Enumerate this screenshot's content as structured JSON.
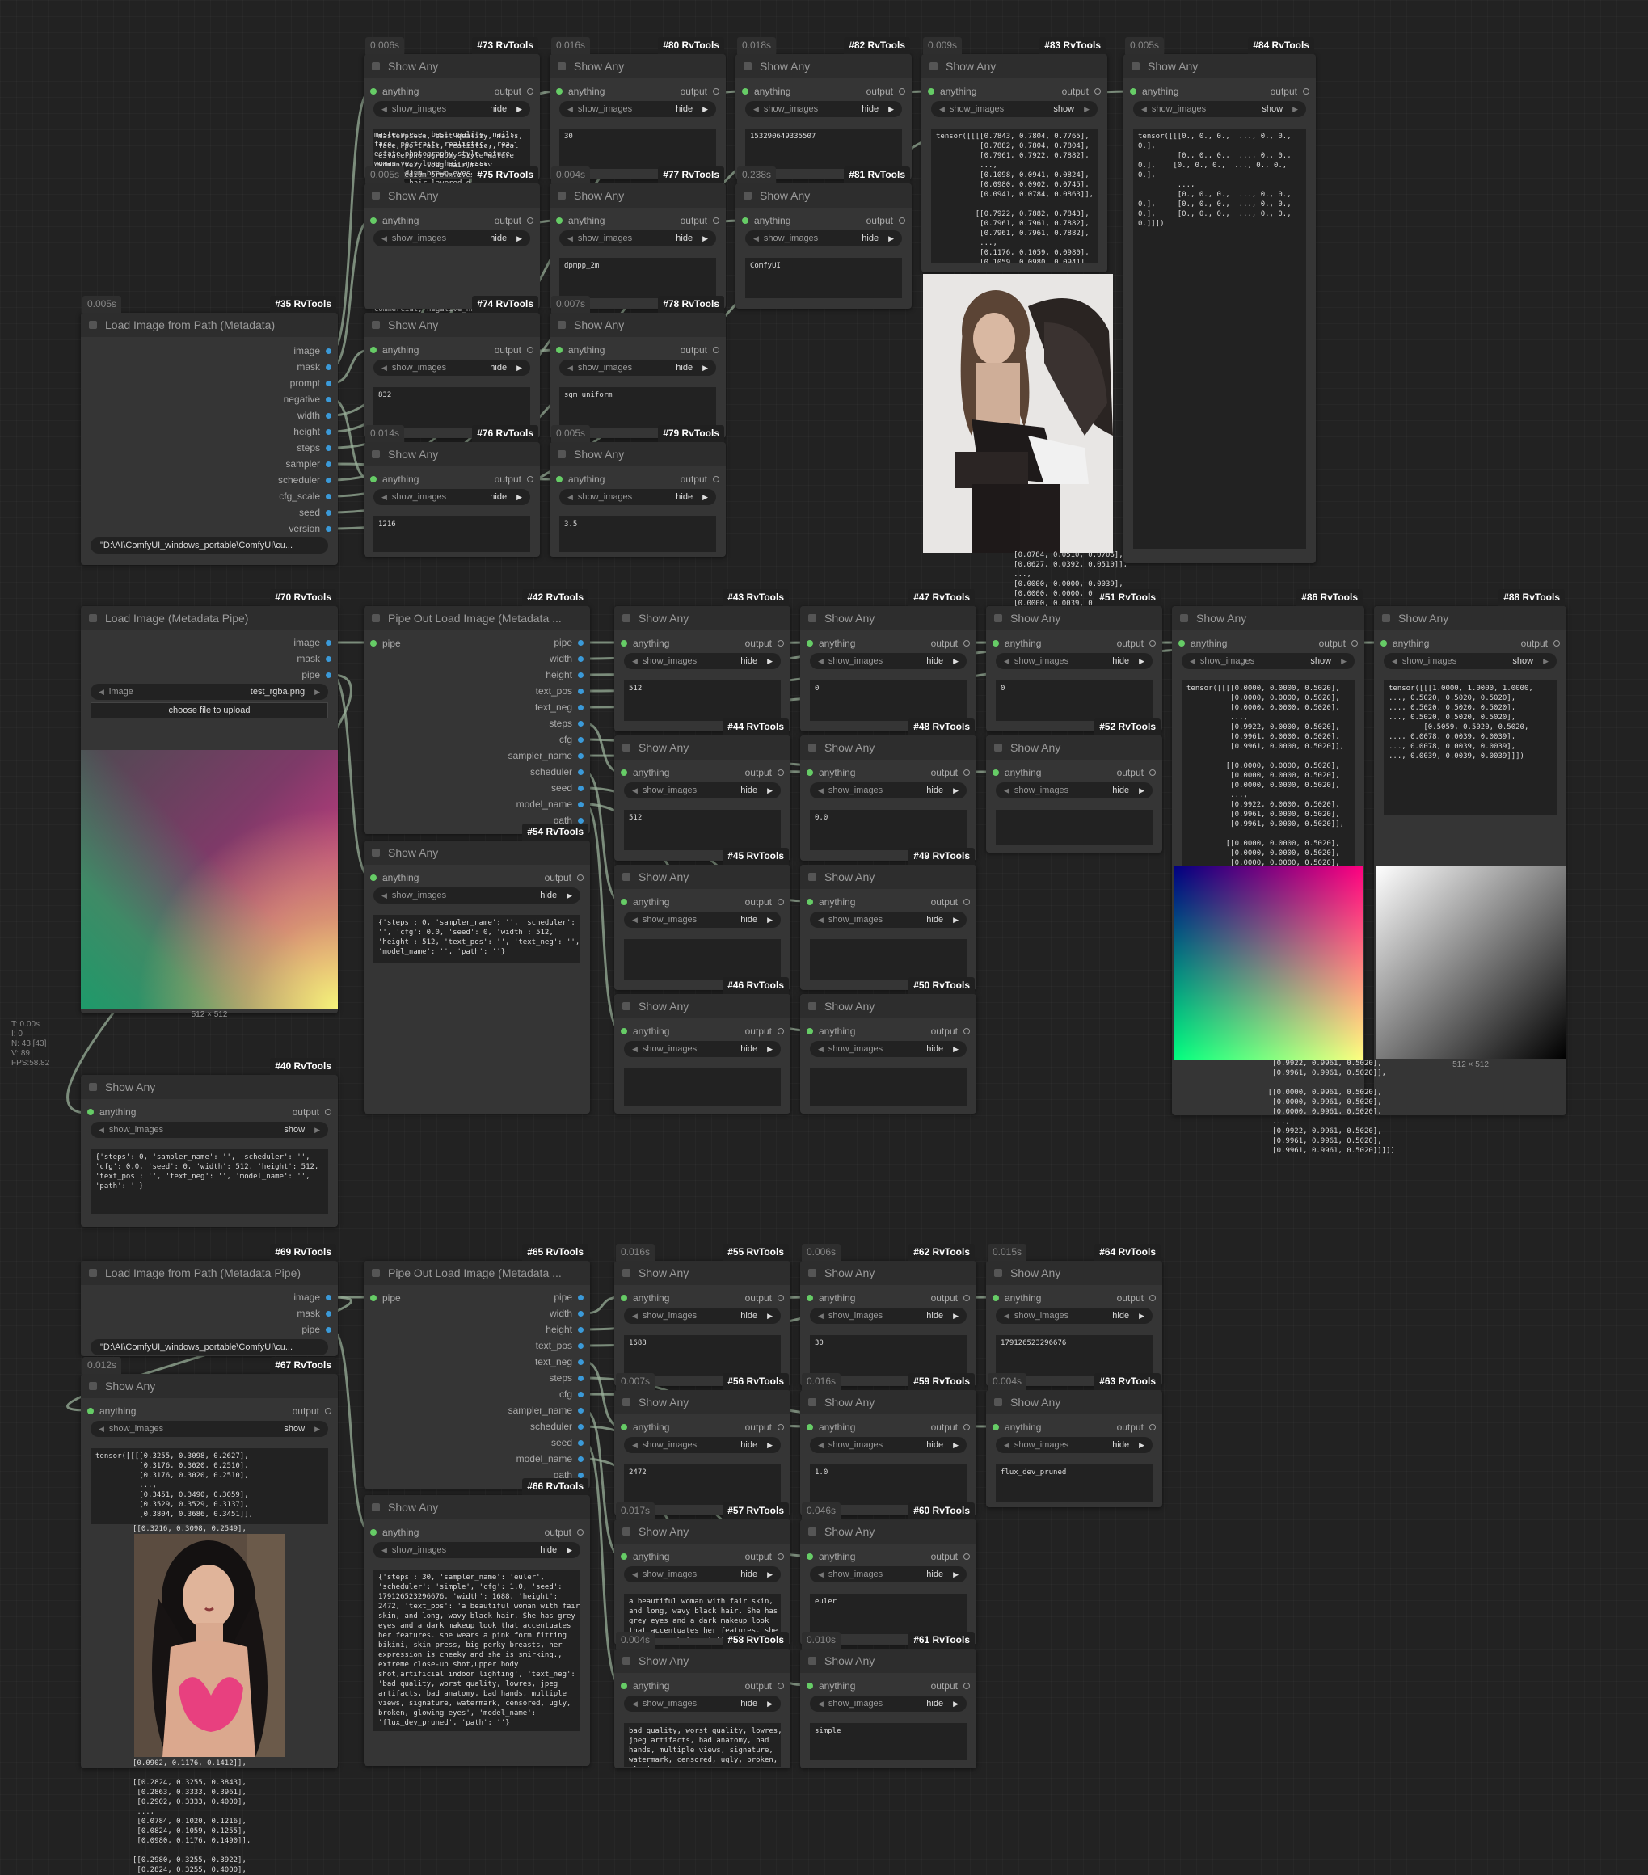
{
  "stats": [
    "T: 0.00s",
    "I: 0",
    "N: 43 [43]",
    "V: 89",
    "FPS:58.82"
  ],
  "common": {
    "show_any": "Show Any",
    "anything": "anything",
    "output": "output",
    "show_images": "show_images",
    "hide": "hide",
    "show": "show",
    "pipe": "pipe"
  },
  "nodes": {
    "n35": {
      "badge": "#35 RvTools",
      "time": "0.005s",
      "title": "Load Image from Path (Metadata)",
      "outputs": [
        "image",
        "mask",
        "prompt",
        "negative",
        "width",
        "height",
        "steps",
        "sampler",
        "scheduler",
        "cfg_scale",
        "seed",
        "version"
      ],
      "path": "\"D:\\AI\\ComfyUI_windows_portable\\ComfyUI\\cu..."
    },
    "n73": {
      "badge": "#73 RvTools",
      "time": "0.006s",
      "text": "masterpiece, best quality, nails,\nface, portrait, realistic,, real\nestate photography style mature\nwoman,very long hair,messy\nhair,medium brown,eyes visible\nthrough hair,layered dress,angel\nwings,tattoo,torn\nthighhighs,dagger,,\nsideways,eye-level shot,Alejandro\nJodorowsky,chris leib,Lifestyle\nPhotography,subdued\nnightlight,Tranquil\nAtmosphere,Photorealism,, starry\nsky\",\"text_neg\": \"blurry, noisy,\nlow resolution, low quality, worst\nquality, vibrant, lens flare,\nbadscales,bad anatomy, bad hands,\nerror, missing, lowres,\ncommercial, negative_hand,\nmasterpiece, best quality, nails,\nface, portrait, realistic,"
    },
    "n80": {
      "badge": "#80 RvTools",
      "time": "0.016s",
      "text": "30"
    },
    "n82": {
      "badge": "#82 RvTools",
      "time": "0.018s",
      "text": "153290649335507"
    },
    "n83": {
      "badge": "#83 RvTools",
      "time": "0.009s",
      "text": "tensor([[[[0.7843, 0.7804, 0.7765],\n          [0.7882, 0.7804, 0.7804],\n          [0.7961, 0.7922, 0.7882],\n          ...,\n          [0.1098, 0.0941, 0.0824],\n          [0.0980, 0.0902, 0.0745],\n          [0.0941, 0.0784, 0.0863]],\n\n         [[0.7922, 0.7882, 0.7843],\n          [0.7961, 0.7961, 0.7882],\n          [0.7961, 0.7961, 0.7882],\n          ...,\n          [0.1176, 0.1059, 0.0980],\n          [0.1059, 0.0980, 0.0941],\n          [0.0902, 0.0784, 0.0824]],",
      "overflow": "          [0.0784, 0.0510, 0.0706],\n          [0.0627, 0.0392, 0.0510]],\n          ...,\n          [0.0000, 0.0000, 0.0039],\n          [0.0000, 0.0000, 0.0000],\n          [0.0000, 0.0039, 0.0196]]]])"
    },
    "n84": {
      "badge": "#84 RvTools",
      "time": "0.005s",
      "text": "tensor([[[0., 0., 0.,  ..., 0., 0.,\n0.],\n         [0., 0., 0.,  ..., 0., 0.,\n0.],    [0., 0., 0.,  ..., 0., 0.,\n0.],\n         ...,\n         [0., 0., 0.,  ..., 0., 0.,\n0.],     [0., 0., 0.,  ..., 0., 0.,\n0.],     [0., 0., 0.,  ..., 0., 0.,\n0.]]])"
    },
    "n75": {
      "badge": "#75 RvTools",
      "time": "0.005s"
    },
    "n77": {
      "badge": "#77 RvTools",
      "time": "0.004s",
      "text": "dpmpp_2m"
    },
    "n81": {
      "badge": "#81 RvTools",
      "time": "0.238s",
      "text": "ComfyUI"
    },
    "n74": {
      "badge": "#74 RvTools",
      "time": "",
      "text": "832"
    },
    "n78": {
      "badge": "#78 RvTools",
      "time": "0.007s",
      "text": "sgm_uniform"
    },
    "n76": {
      "badge": "#76 RvTools",
      "time": "0.014s",
      "text": "1216"
    },
    "n79": {
      "badge": "#79 RvTools",
      "time": "0.005s",
      "text": "3.5"
    },
    "n70": {
      "badge": "#70 RvTools",
      "title": "Load Image (Metadata Pipe)",
      "outputs": [
        "image",
        "mask",
        "pipe"
      ],
      "combo_label": "image",
      "combo_value": "test_rgba.png",
      "upload": "choose file to upload",
      "caption": "512 × 512"
    },
    "n42": {
      "badge": "#42 RvTools",
      "title": "Pipe Out Load Image (Metadata ...",
      "outputs": [
        "pipe",
        "width",
        "height",
        "text_pos",
        "text_neg",
        "steps",
        "cfg",
        "sampler_name",
        "scheduler",
        "seed",
        "model_name",
        "path"
      ]
    },
    "n43": {
      "badge": "#43 RvTools",
      "text": "512"
    },
    "n47": {
      "badge": "#47 RvTools",
      "text": "0"
    },
    "n51": {
      "badge": "#51 RvTools",
      "text": "0"
    },
    "n86": {
      "badge": "#86 RvTools",
      "text": "tensor([[[[0.0000, 0.0000, 0.5020],\n          [0.0000, 0.0000, 0.5020],\n          [0.0000, 0.0000, 0.5020],\n          ...,\n          [0.9922, 0.0000, 0.5020],\n          [0.9961, 0.0000, 0.5020],\n          [0.9961, 0.0000, 0.5020]],\n\n         [[0.0000, 0.0000, 0.5020],\n          [0.0000, 0.0000, 0.5020],\n          [0.0000, 0.0000, 0.5020],\n          ...,\n          [0.9922, 0.0000, 0.5020],\n          [0.9961, 0.0000, 0.5020],\n          [0.9961, 0.0000, 0.5020]],\n\n         [[0.0000, 0.0000, 0.5020],\n          [0.0000, 0.0000, 0.5020],\n          [0.0000, 0.0000, 0.5020],",
      "overflow": "          [0.9922, 0.9961, 0.5020],\n          [0.9961, 0.9961, 0.5020]],\n\n         [[0.0000, 0.9961, 0.5020],\n          [0.0000, 0.9961, 0.5020],\n          [0.0000, 0.9961, 0.5020],\n          ...,\n          [0.9922, 0.9961, 0.5020],\n          [0.9961, 0.9961, 0.5020],\n          [0.9961, 0.9961, 0.5020]]]])"
    },
    "n88": {
      "badge": "#88 RvTools",
      "text": "tensor([[[1.0000, 1.0000, 1.0000,\n..., 0.5020, 0.5020, 0.5020],\n..., 0.5020, 0.5020, 0.5020],\n..., 0.5020, 0.5020, 0.5020],\n        [0.5059, 0.5020, 0.5020,\n..., 0.0078, 0.0039, 0.0039],\n..., 0.0078, 0.0039, 0.0039],\n..., 0.0039, 0.0039, 0.0039]]])",
      "caption": "512 × 512"
    },
    "n44": {
      "badge": "#44 RvTools",
      "text": "512"
    },
    "n48": {
      "badge": "#48 RvTools",
      "text": "0.0"
    },
    "n52": {
      "badge": "#52 RvTools",
      "text": ""
    },
    "n54": {
      "badge": "#54 RvTools",
      "text": "{'steps': 0, 'sampler_name': '', 'scheduler':\n'', 'cfg': 0.0, 'seed': 0, 'width': 512,\n'height': 512, 'text_pos': '', 'text_neg': '',\n'model_name': '', 'path': ''}"
    },
    "n45": {
      "badge": "#45 RvTools",
      "text": ""
    },
    "n49": {
      "badge": "#49 RvTools",
      "text": ""
    },
    "n46": {
      "badge": "#46 RvTools",
      "text": ""
    },
    "n50": {
      "badge": "#50 RvTools",
      "text": ""
    },
    "n40": {
      "badge": "#40 RvTools",
      "text": "{'steps': 0, 'sampler_name': '', 'scheduler': '',\n'cfg': 0.0, 'seed': 0, 'width': 512, 'height': 512,\n'text_pos': '', 'text_neg': '', 'model_name': '',\n'path': ''}"
    },
    "n69": {
      "badge": "#69 RvTools",
      "title": "Load Image from Path (Metadata Pipe)",
      "outputs": [
        "image",
        "mask",
        "pipe"
      ],
      "path": "\"D:\\AI\\ComfyUI_windows_portable\\ComfyUI\\cu..."
    },
    "n65": {
      "badge": "#65 RvTools",
      "title": "Pipe Out Load Image (Metadata ...",
      "outputs": [
        "pipe",
        "width",
        "height",
        "text_pos",
        "text_neg",
        "steps",
        "cfg",
        "sampler_name",
        "scheduler",
        "seed",
        "model_name",
        "path"
      ]
    },
    "n55": {
      "badge": "#55 RvTools",
      "time": "0.016s",
      "text": "1688"
    },
    "n62": {
      "badge": "#62 RvTools",
      "time": "0.006s",
      "text": "30"
    },
    "n64": {
      "badge": "#64 RvTools",
      "time": "0.015s",
      "text": "179126523296676"
    },
    "n56": {
      "badge": "#56 RvTools",
      "time": "0.007s",
      "text": "2472"
    },
    "n59": {
      "badge": "#59 RvTools",
      "time": "0.016s",
      "text": "1.0"
    },
    "n63": {
      "badge": "#63 RvTools",
      "time": "0.004s",
      "text": "flux_dev_pruned"
    },
    "n57": {
      "badge": "#57 RvTools",
      "time": "0.017s",
      "text": "a beautiful woman with fair skin,\nand long, wavy black hair. She has\ngrey eyes and a dark makeup look\nthat accentuates her features. she\nwears a pink form fitting bikini,\nskin press, big perky breasts, her"
    },
    "n60": {
      "badge": "#60 RvTools",
      "time": "0.046s",
      "text": "euler"
    },
    "n58": {
      "badge": "#58 RvTools",
      "time": "0.004s",
      "text": "bad quality, worst quality, lowres,\njpeg artifacts, bad anatomy, bad\nhands, multiple views, signature,\nwatermark, censored, ugly, broken,\nglowing eyes"
    },
    "n61": {
      "badge": "#61 RvTools",
      "time": "0.010s",
      "text": "simple"
    },
    "n66": {
      "badge": "#66 RvTools",
      "text": "{'steps': 30, 'sampler_name': 'euler',\n'scheduler': 'simple', 'cfg': 1.0, 'seed':\n179126523296676, 'width': 1688, 'height':\n2472, 'text_pos': 'a beautiful woman with fair\nskin, and long, wavy black hair. She has grey\neyes and a dark makeup look that accentuates\nher features. she wears a pink form fitting\nbikini, skin press, big perky breasts, her\nexpression is cheeky and she is smirking.,\nextreme close-up shot,upper body\nshot,artificial indoor lighting', 'text_neg':\n'bad quality, worst quality, lowres, jpeg\nartifacts, bad anatomy, bad hands, multiple\nviews, signature, watermark, censored, ugly,\nbroken, glowing eyes', 'model_name':\n'flux_dev_pruned', 'path': ''}"
    },
    "n67": {
      "badge": "#67 RvTools",
      "time": "0.012s",
      "text": "tensor([[[[0.3255, 0.3098, 0.2627],\n          [0.3176, 0.3020, 0.2510],\n          [0.3176, 0.3020, 0.2510],\n          ...,\n          [0.3451, 0.3490, 0.3059],\n          [0.3529, 0.3529, 0.3137],\n          [0.3804, 0.3686, 0.3451]],",
      "overflow": "[[0.3216, 0.3098, 0.2549],",
      "overflow2": "[0.0902, 0.1176, 0.1412]],\n\n[[0.2824, 0.3255, 0.3843],\n [0.2863, 0.3333, 0.3961],\n [0.2902, 0.3333, 0.4000],\n ...,\n [0.0784, 0.1020, 0.1216],\n [0.0824, 0.1059, 0.1255],\n [0.0980, 0.1176, 0.1490]],\n\n[[0.2980, 0.3255, 0.3922],\n [0.2824, 0.3255, 0.4000],"
    }
  }
}
